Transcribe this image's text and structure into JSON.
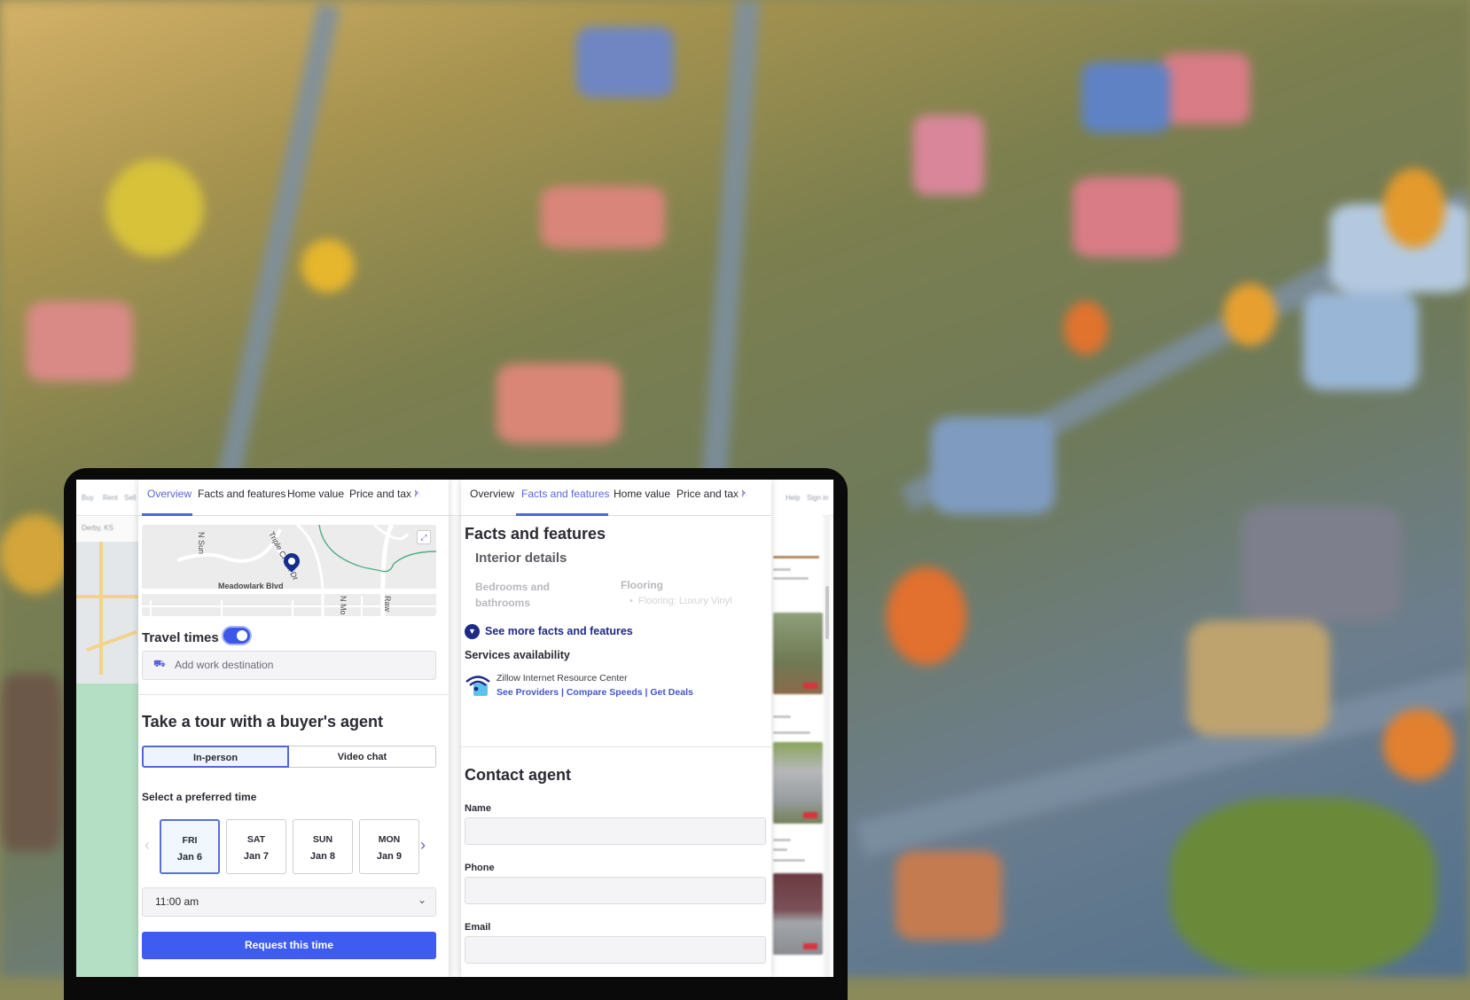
{
  "background": {
    "description": "blurred aerial photo of suburban neighborhood"
  },
  "left_panel": {
    "tabs": [
      {
        "label": "Overview",
        "active": true
      },
      {
        "label": "Facts and features",
        "active": false
      },
      {
        "label": "Home value",
        "active": false
      },
      {
        "label": "Price and tax h",
        "active": false
      }
    ],
    "map": {
      "street_labels": [
        "N Sun",
        "Triple Creek Dr",
        "Meadowlark Blvd",
        "N Mo",
        "Raw"
      ]
    },
    "travel_times": {
      "label": "Travel times",
      "enabled": true
    },
    "work_destination": {
      "placeholder": "Add work destination"
    },
    "tour": {
      "title": "Take a tour with a buyer's agent",
      "modes": [
        {
          "label": "In-person",
          "selected": true
        },
        {
          "label": "Video chat",
          "selected": false
        }
      ],
      "select_label": "Select a preferred time",
      "dates": [
        {
          "day": "FRI",
          "date": "Jan 6",
          "selected": true
        },
        {
          "day": "SAT",
          "date": "Jan 7",
          "selected": false
        },
        {
          "day": "SUN",
          "date": "Jan 8",
          "selected": false
        },
        {
          "day": "MON",
          "date": "Jan 9",
          "selected": false
        }
      ],
      "time_value": "11:00 am",
      "request_button": "Request this time"
    }
  },
  "right_panel": {
    "tabs": [
      {
        "label": "Overview",
        "active": false
      },
      {
        "label": "Facts and features",
        "active": true
      },
      {
        "label": "Home value",
        "active": false
      },
      {
        "label": "Price and tax h",
        "active": false
      }
    ],
    "facts_title": "Facts and features",
    "interior_title": "Interior details",
    "bedrooms_label": "Bedrooms and bathrooms",
    "flooring_label": "Flooring",
    "flooring_item": "Flooring: Luxury Vinyl",
    "see_more": "See more facts and features",
    "services_title": "Services availability",
    "services_provider": "Zillow Internet Resource Center",
    "services_links": [
      "See Providers",
      "Compare Speeds",
      "Get Deals"
    ],
    "contact_title": "Contact agent",
    "fields": [
      {
        "label": "Name",
        "value": ""
      },
      {
        "label": "Phone",
        "value": ""
      },
      {
        "label": "Email",
        "value": ""
      }
    ]
  },
  "colors": {
    "accent": "#3e5df0",
    "tab_active": "#5b64d9",
    "link": "#4256d0",
    "dark_blue": "#1d2a86"
  }
}
